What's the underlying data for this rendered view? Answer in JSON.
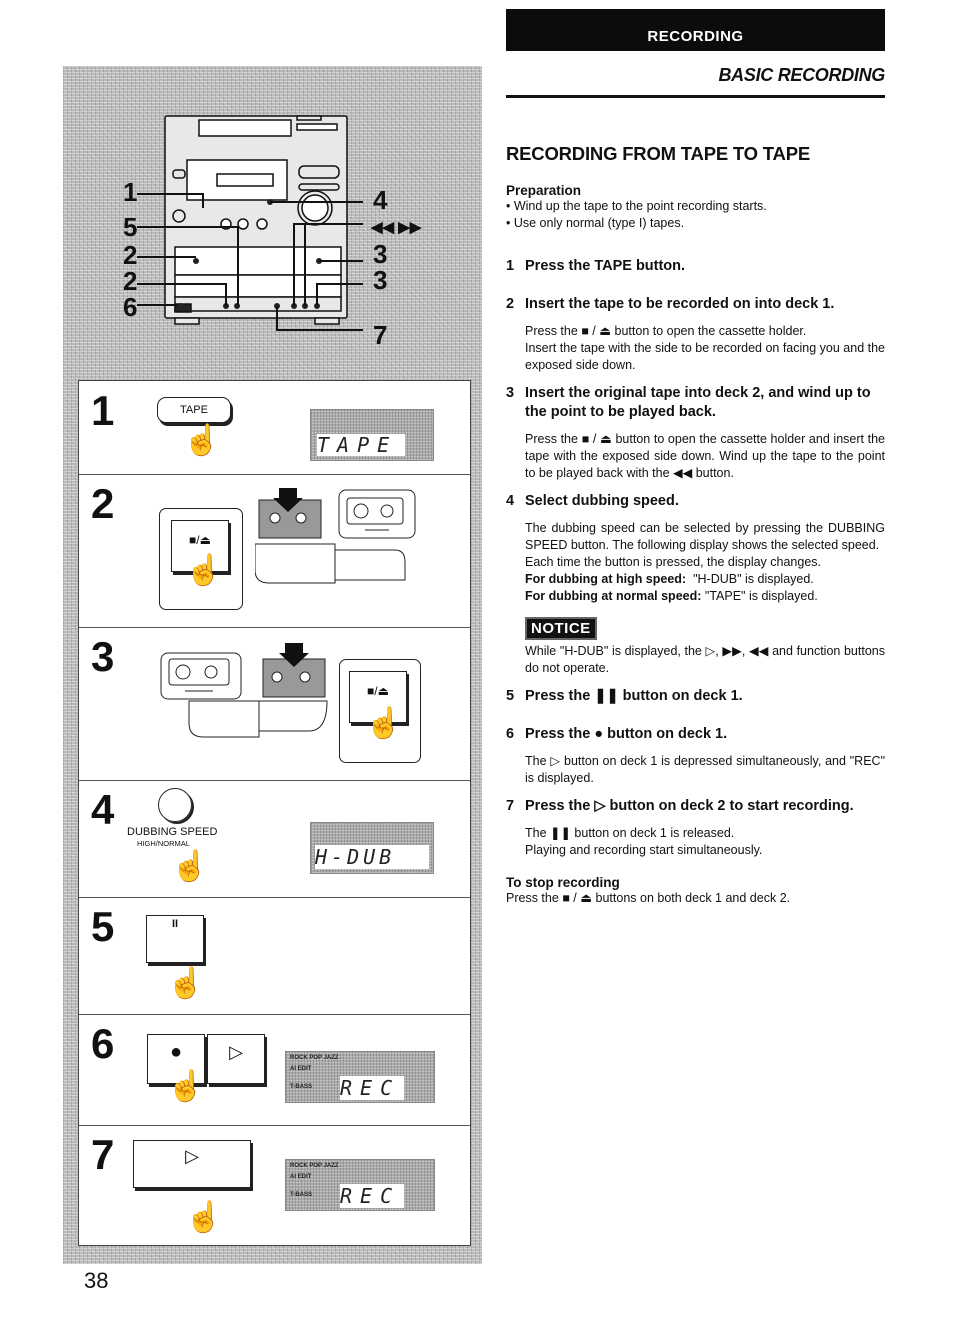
{
  "header": {
    "section": "RECORDING",
    "subtitle": "BASIC RECORDING"
  },
  "page_title": "RECORDING FROM TAPE TO TAPE",
  "preparation": {
    "heading": "Preparation",
    "bullets": [
      "• Wind up the tape to the point recording starts.",
      "• Use only normal (type I) tapes."
    ]
  },
  "steps": [
    {
      "num": "1",
      "heading": "Press the TAPE button.",
      "body": []
    },
    {
      "num": "2",
      "heading": "Insert the tape to be recorded on into deck 1.",
      "body": [
        "Press the ■ / ⏏ button to open the cassette holder.",
        "Insert the tape with the side to be recorded on facing you and the exposed side down."
      ]
    },
    {
      "num": "3",
      "heading": "Insert the original tape into deck 2, and wind up to the point to be played back.",
      "body": [
        "Press the ■ / ⏏ button to open the cassette holder and insert the tape with the exposed side down. Wind up the tape to the point to be played back with the ◀◀ button."
      ]
    },
    {
      "num": "4",
      "heading": "Select dubbing speed.",
      "body": [
        "The dubbing speed can be selected by pressing the DUBBING SPEED button. The following display shows the selected speed.",
        "Each time the button is pressed, the display changes."
      ],
      "high_label": "For dubbing at high speed:",
      "high_value": "\"H-DUB\" is displayed.",
      "normal_label": "For dubbing at normal speed:",
      "normal_value": "\"TAPE\" is displayed.",
      "notice_label": "NOTICE",
      "notice_text": "While \"H-DUB\" is displayed, the ▷, ▶▶, ◀◀ and function buttons do not operate."
    },
    {
      "num": "5",
      "heading": "Press the ❚❚ button on deck 1.",
      "body": []
    },
    {
      "num": "6",
      "heading": "Press the ● button on deck 1.",
      "body": [
        "The ▷ button on deck 1 is depressed simultaneously, and \"REC\" is displayed."
      ]
    },
    {
      "num": "7",
      "heading": "Press the ▷ button on deck 2 to start recording.",
      "body": [
        "The ❚❚ button on deck 1 is released.",
        "Playing and recording start simultaneously."
      ]
    }
  ],
  "stop": {
    "heading": "To stop recording",
    "text": "Press the ■ / ⏏ buttons on both deck 1 and deck 2."
  },
  "illustration": {
    "callouts": [
      "1",
      "5",
      "2",
      "2",
      "6",
      "4",
      "◀◀ ▶▶",
      "3",
      "3",
      "7"
    ],
    "panels": [
      {
        "num": "1",
        "button": "TAPE",
        "display": "TAPE"
      },
      {
        "num": "2",
        "button": "■/⏏"
      },
      {
        "num": "3",
        "button": "■/⏏"
      },
      {
        "num": "4",
        "button_label": "DUBBING SPEED",
        "button_sub": "HIGH/NORMAL",
        "display": "H-DUB"
      },
      {
        "num": "5",
        "button": "II"
      },
      {
        "num": "6",
        "buttons": [
          "●",
          "▷"
        ],
        "display": "REC",
        "indicators": [
          "ROCK  POP  JAZZ",
          "AI EDIT",
          "T-BASS"
        ]
      },
      {
        "num": "7",
        "button": "▷",
        "display": "REC",
        "indicators": [
          "ROCK  POP  JAZZ",
          "AI EDIT",
          "T-BASS"
        ]
      }
    ]
  },
  "page_number": "38"
}
